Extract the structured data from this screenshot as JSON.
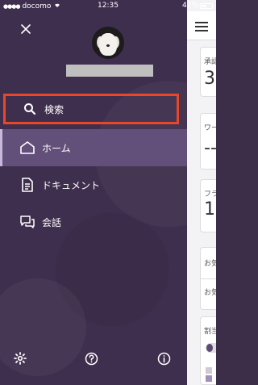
{
  "status_bar": {
    "carrier": "docomo",
    "time": "12:35",
    "battery": "42%"
  },
  "drawer": {
    "menu": [
      {
        "id": "search",
        "label": "検索",
        "icon": "search-icon"
      },
      {
        "id": "home",
        "label": "ホーム",
        "icon": "home-icon",
        "selected": true
      },
      {
        "id": "docs",
        "label": "ドキュメント",
        "icon": "document-icon"
      },
      {
        "id": "talk",
        "label": "会話",
        "icon": "chat-icon"
      }
    ],
    "bottom_icons": [
      "gear-icon",
      "help-icon",
      "info-icon"
    ],
    "highlight_color": "#e8472a",
    "background_color": "#3f2f4e",
    "selected_color": "#62507a"
  },
  "main_peek": {
    "cards": [
      {
        "label": "承認",
        "value": "3"
      },
      {
        "label": "ワー",
        "value": "--"
      },
      {
        "label": "フラ",
        "value": "1"
      },
      {
        "label": "お気",
        "label2": "お気"
      },
      {
        "label": "割当"
      }
    ]
  }
}
